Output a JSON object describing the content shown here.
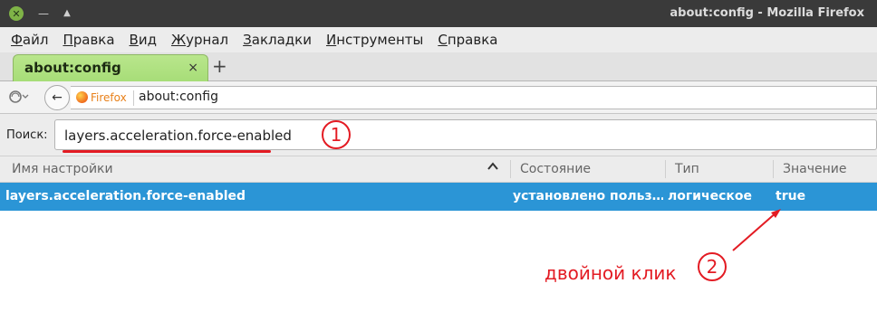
{
  "window": {
    "title": "about:config - Mozilla Firefox"
  },
  "menu": [
    {
      "label": "Файл"
    },
    {
      "label": "Правка"
    },
    {
      "label": "Вид"
    },
    {
      "label": "Журнал"
    },
    {
      "label": "Закладки"
    },
    {
      "label": "Инструменты"
    },
    {
      "label": "Справка"
    }
  ],
  "tab": {
    "label": "about:config",
    "close": "×",
    "new_tab": "+"
  },
  "navbar": {
    "back": "←",
    "identity": "Firefox",
    "url": "about:config",
    "identity_color": "#e8801a"
  },
  "search": {
    "label": "Поиск:",
    "value": "layers.acceleration.force-enabled"
  },
  "table": {
    "headers": [
      "Имя настройки",
      "Состояние",
      "Тип",
      "Значение"
    ],
    "rows": [
      {
        "name": "layers.acceleration.force-enabled",
        "status": "установлено польз…",
        "type": "логическое",
        "value": "true"
      }
    ],
    "selected_color": "#2b95d6"
  },
  "annotations": {
    "step1": "1",
    "step2": "2",
    "hint": "двойной клик",
    "color": "#e31b23"
  }
}
